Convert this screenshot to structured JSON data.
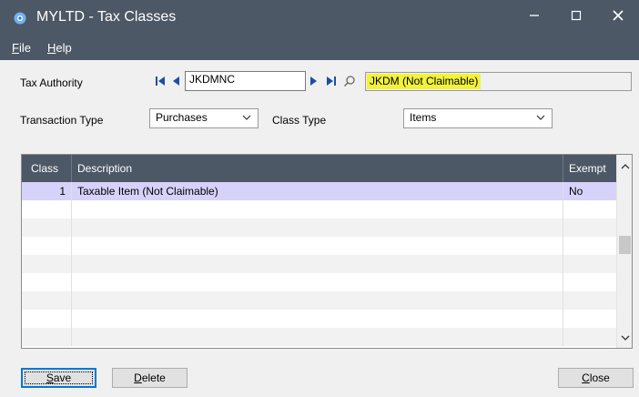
{
  "window": {
    "title": "MYLTD - Tax Classes",
    "min_label": "–",
    "max_label": "☐",
    "close_label": "✕"
  },
  "menu": {
    "file_first": "F",
    "file_rest": "ile",
    "help_first": "H",
    "help_rest": "elp"
  },
  "form": {
    "tax_authority_label": "Tax Authority",
    "tax_authority_code": "JKDMNC",
    "tax_authority_desc": "JKDM (Not Claimable)",
    "transaction_type_label": "Transaction Type",
    "transaction_type_value": "Purchases",
    "class_type_label": "Class Type",
    "class_type_value": "Items"
  },
  "grid": {
    "columns": [
      "Class",
      "Description",
      "Exempt"
    ],
    "rows": [
      {
        "class": "1",
        "description": "Taxable Item (Not Claimable)",
        "exempt": "No"
      }
    ],
    "scroll_position": 0.45
  },
  "buttons": {
    "save_first": "S",
    "save_rest": "ave",
    "delete_first": "D",
    "delete_rest": "elete",
    "close_first": "C",
    "close_rest": "lose"
  },
  "colors": {
    "chrome": "#4d5866",
    "selected_row": "#d7d2fa",
    "highlight": "#f2f23a",
    "nav_arrow": "#1a4fa8"
  },
  "icons": {
    "app": "gear-icon",
    "first": "first-record-icon",
    "prev": "previous-record-icon",
    "next": "next-record-icon",
    "last": "last-record-icon",
    "finder": "search-icon",
    "dropdown": "chevron-down-icon"
  }
}
